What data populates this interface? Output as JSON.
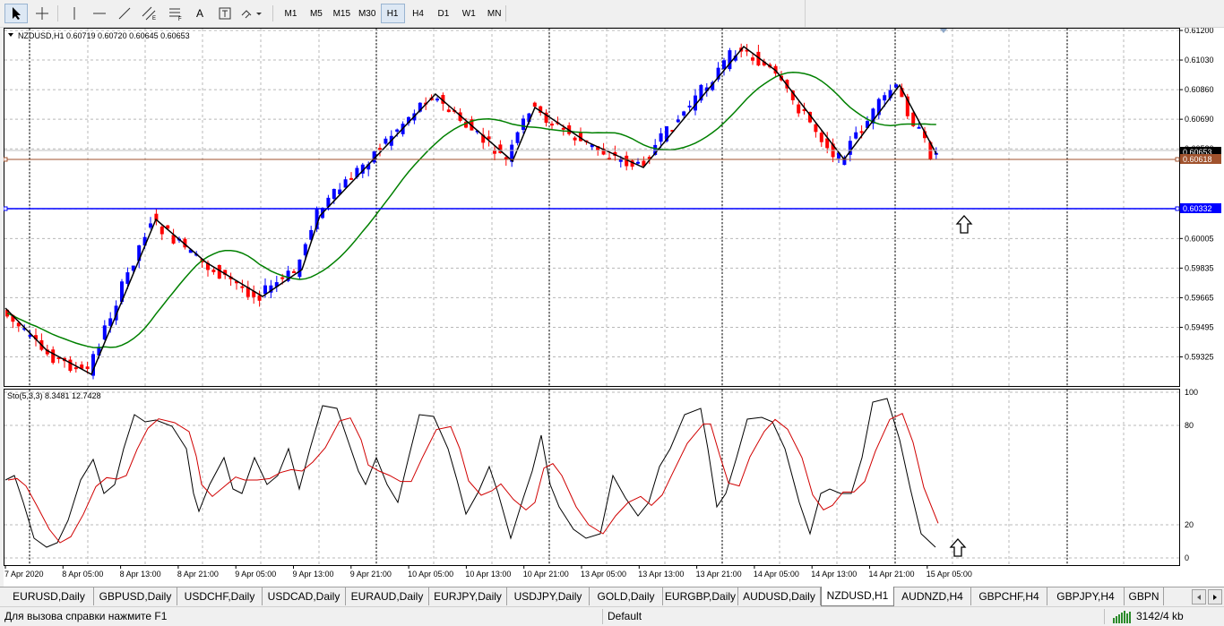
{
  "toolbar": {
    "timeframes": [
      {
        "label": "M1"
      },
      {
        "label": "M5"
      },
      {
        "label": "M15"
      },
      {
        "label": "M30"
      },
      {
        "label": "H1",
        "selected": true
      },
      {
        "label": "H4"
      },
      {
        "label": "D1"
      },
      {
        "label": "W1"
      },
      {
        "label": "MN"
      }
    ],
    "text_tool_label": "A"
  },
  "chart": {
    "info": "NZDUSD,H1  0.60719 0.60720 0.60645 0.60653",
    "indicator": "Sto(5,3,3) 8.3481 12.7428",
    "price_ticks": [
      "0.61200",
      "0.61030",
      "0.60860",
      "0.60690",
      "0.60520",
      "0.60175",
      "0.60005",
      "0.59835",
      "0.59665",
      "0.59495",
      "0.59325"
    ],
    "price_labels": {
      "bid": "0.60653",
      "line1": "0.60618",
      "line2": "0.60332"
    },
    "sto_ticks": [
      "100",
      "80",
      "20",
      "0"
    ],
    "time_ticks": [
      "7 Apr 2020",
      "8 Apr 05:00",
      "8 Apr 13:00",
      "8 Apr 21:00",
      "9 Apr 05:00",
      "9 Apr 13:00",
      "9 Apr 21:00",
      "10 Apr 05:00",
      "10 Apr 13:00",
      "10 Apr 21:00",
      "13 Apr 05:00",
      "13 Apr 13:00",
      "13 Apr 21:00",
      "14 Apr 05:00",
      "14 Apr 13:00",
      "14 Apr 21:00",
      "15 Apr 05:00"
    ],
    "colors": {
      "bull": "#0000ff",
      "bear": "#ff0000",
      "ma": "#008000",
      "zigzag": "#000000",
      "line_brown": "#a0522d",
      "line_blue": "#0000ff",
      "grid": "#b8b8b8"
    }
  },
  "tabs": [
    "EURUSD,Daily",
    "GBPUSD,Daily",
    "USDCHF,Daily",
    "USDCAD,Daily",
    "EURAUD,Daily",
    "EURJPY,Daily",
    "USDJPY,Daily",
    "GOLD,Daily",
    "EURGBP,Daily",
    "AUDUSD,Daily",
    "NZDUSD,H1",
    "AUDNZD,H4",
    "GBPCHF,H4",
    "GBPJPY,H4",
    "GBPN"
  ],
  "active_tab": "NZDUSD,H1",
  "status": {
    "help": "Для вызова справки нажмите F1",
    "profile": "Default",
    "traffic": "3142/4 kb"
  }
}
